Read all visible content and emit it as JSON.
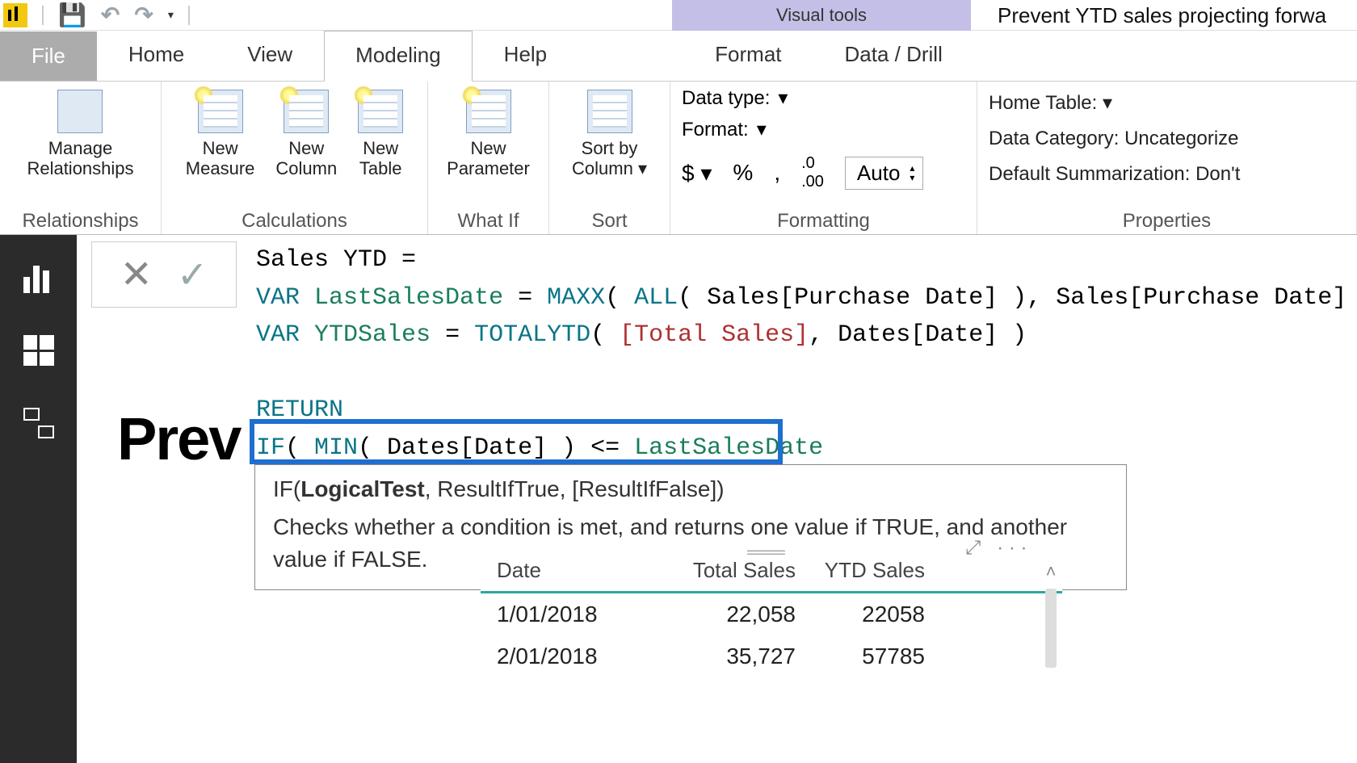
{
  "titlebar": {
    "visual_tools": "Visual tools",
    "doc_title": "Prevent YTD sales projecting forwa"
  },
  "tabs": {
    "file": "File",
    "home": "Home",
    "view": "View",
    "modeling": "Modeling",
    "help": "Help",
    "format": "Format",
    "data_drill": "Data / Drill"
  },
  "ribbon": {
    "relationships_group": "Relationships",
    "manage_rel_l1": "Manage",
    "manage_rel_l2": "Relationships",
    "calculations_group": "Calculations",
    "new_measure_l1": "New",
    "new_measure_l2": "Measure",
    "new_column_l1": "New",
    "new_column_l2": "Column",
    "new_table_l1": "New",
    "new_table_l2": "Table",
    "whatif_group": "What If",
    "new_param_l1": "New",
    "new_param_l2": "Parameter",
    "sort_group": "Sort",
    "sortby_l1": "Sort by",
    "sortby_l2": "Column",
    "formatting_group": "Formatting",
    "data_type": "Data type:",
    "format": "Format:",
    "currency": "$",
    "percent": "%",
    "comma": ",",
    "auto": "Auto",
    "properties_group": "Properties",
    "home_table": "Home Table:",
    "data_category": "Data Category: Uncategorize",
    "default_summ": "Default Summarization: Don't"
  },
  "dax": {
    "line1a": "Sales YTD =",
    "line2_var": "VAR",
    "line2_name": "LastSalesDate",
    "line2_eq": " = ",
    "line2_fn1": "MAXX",
    "line2_p1": "( ",
    "line2_fn2": "ALL",
    "line2_p2": "( Sales[Purchase Date] ), Sales[Purchase Date] )",
    "line3_var": "VAR",
    "line3_name": "YTDSales",
    "line3_eq": " = ",
    "line3_fn": "TOTALYTD",
    "line3_p1": "( ",
    "line3_meas": "[Total Sales]",
    "line3_p2": ", Dates[Date] )",
    "line4_ret": "RETURN",
    "line5_if": "IF",
    "line5_p1": "( ",
    "line5_min": "MIN",
    "line5_p2": "( Dates[Date] ) <= ",
    "line5_lsd": "LastSalesDate"
  },
  "tooltip": {
    "sig_pre": "IF(",
    "sig_bold": "LogicalTest",
    "sig_post": ", ResultIfTrue, [ResultIfFalse])",
    "desc": "Checks whether a condition is met, and returns one value if TRUE, and another value if FALSE."
  },
  "canvas_title": "Prev",
  "table": {
    "h_date": "Date",
    "h_total": "Total Sales",
    "h_ytd": "YTD Sales",
    "rows": [
      {
        "date": "1/01/2018",
        "total": "22,058",
        "ytd": "22058"
      },
      {
        "date": "2/01/2018",
        "total": "35,727",
        "ytd": "57785"
      }
    ]
  },
  "toolbar_stub": {
    "dots": "· · ·"
  }
}
